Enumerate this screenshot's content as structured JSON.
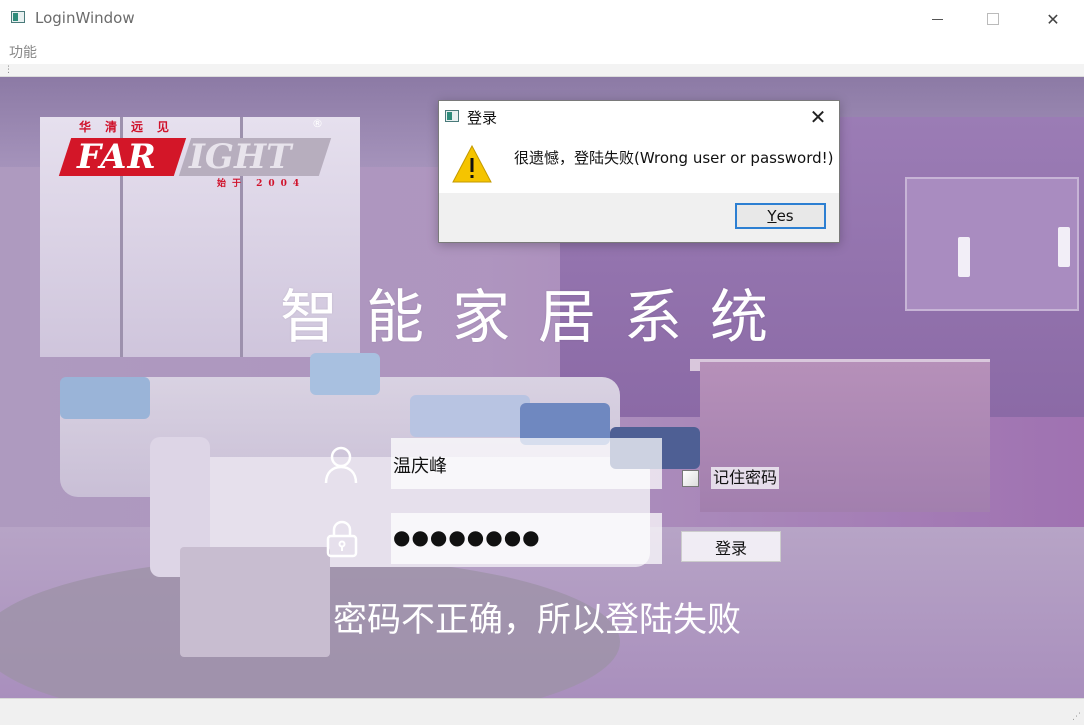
{
  "window": {
    "title": "LoginWindow",
    "minimize_icon": "minimize-icon",
    "maximize_icon": "maximize-icon",
    "close_icon": "close-icon",
    "close_glyph": "✕"
  },
  "menubar": {
    "items": [
      {
        "label": "功能"
      }
    ]
  },
  "logo": {
    "cn_text": "华清远见",
    "brand_left": "FAR",
    "brand_right": "IGHT",
    "reg_mark": "®",
    "year_text": "始于 2004",
    "colors": {
      "red": "#d31628",
      "gray": "#b7aebe"
    }
  },
  "main": {
    "system_title": "智能家居系统",
    "username": "温庆峰",
    "password_mask": "●●●●●●●●",
    "remember_label": "记住密码",
    "remember_checked": false,
    "login_button": "登录",
    "status_message": "密码不正确，所以登陆失败"
  },
  "dialog": {
    "title": "登录",
    "close_glyph": "✕",
    "message": "很遗憾，登陆失败(Wrong user or password!)",
    "icon": "warning-icon",
    "yes_button_mnemonic": "Y",
    "yes_button_rest": "es",
    "colors": {
      "warning": "#f5c400",
      "focus_border": "#2c7fd2"
    }
  }
}
